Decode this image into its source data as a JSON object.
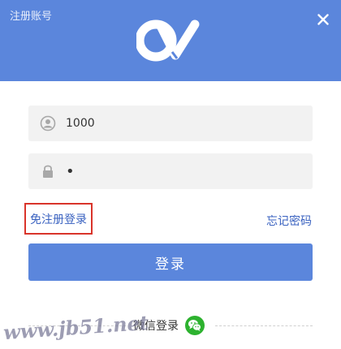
{
  "header": {
    "register_label": "注册账号",
    "close_label": "×",
    "brand_color": "#5b86dc"
  },
  "form": {
    "username_value": "1000",
    "username_icon": "user-icon",
    "password_value": "•",
    "password_icon": "lock-icon"
  },
  "links": {
    "no_register_login": "免注册登录",
    "forgot_password": "忘记密码",
    "highlight_color": "#d9342a"
  },
  "login_button": {
    "label": "登录"
  },
  "wechat": {
    "label": "微信登录",
    "icon": "wechat-icon",
    "color": "#2db22f"
  },
  "watermark": {
    "text": "www.jb51.net"
  }
}
